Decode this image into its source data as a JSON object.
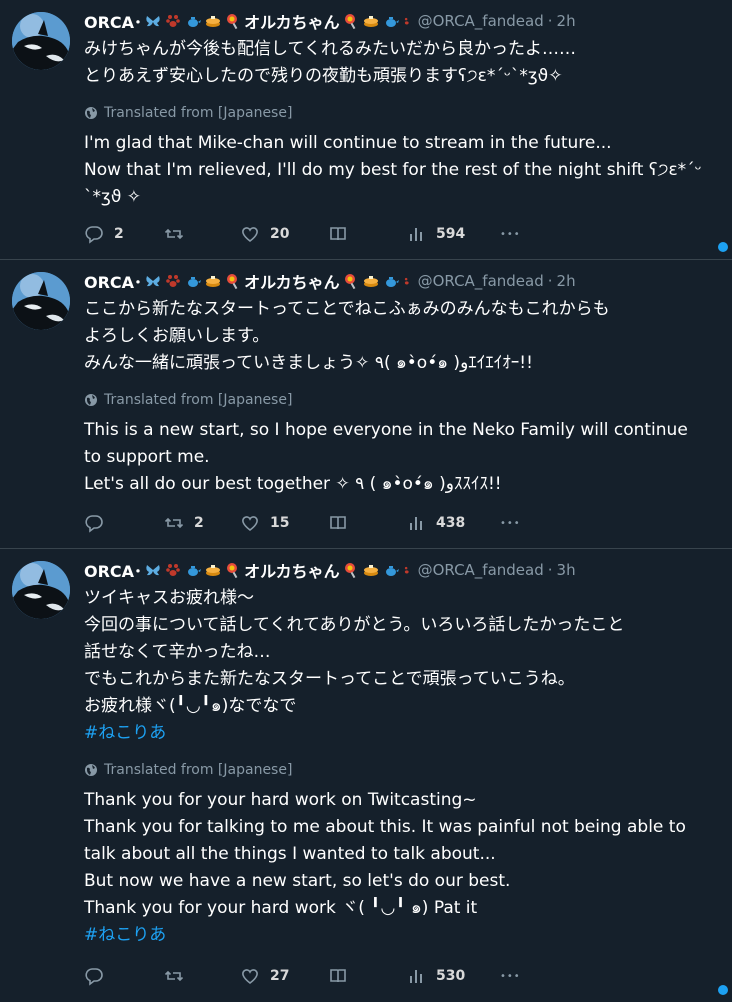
{
  "tweets": [
    {
      "display_name": "ORCA･",
      "name_suffix": "オルカちゃん",
      "handle": "@ORCA_fandead",
      "dot": "·",
      "time": "2h",
      "jp_lines": "みけちゃんが今後も配信してくれるみたいだから良かったよ……\nとりあえず安心したので残りの夜勤も頑張りますʕ੭ɛ*´ᵕ`*ʒϑ✧",
      "hashtag": "",
      "translated_label": "Translated from [Japanese]",
      "en_lines": "I'm glad that Mike-chan will continue to stream in the future...\nNow that I'm relieved, I'll do my best for the rest of the night shift ʕ੭ɛ*´ᵕ\n`*ʒϑ ✧",
      "replies": "2",
      "retweets": "",
      "likes": "20",
      "views": "594",
      "more": "•••"
    },
    {
      "display_name": "ORCA･",
      "name_suffix": "オルカちゃん",
      "handle": "@ORCA_fandead",
      "dot": "·",
      "time": "2h",
      "jp_lines": "ここから新たなスタートってことでねこふぁみのみんなもこれからも\nよろしくお願いします。\nみんな一緒に頑張っていきましょう✧ ٩( ๑•̀o•́๑ )وｴｲｴｲｵｰ!!",
      "hashtag": "",
      "translated_label": "Translated from [Japanese]",
      "en_lines": "This is a new start, so I hope everyone in the Neko Family will continue\nto support me.\nLet's all do our best together ✧ ٩ ( ๑•̀o•́๑ )وｽｽｲｽ!!",
      "replies": "",
      "retweets": "2",
      "likes": "15",
      "views": "438",
      "more": "•••"
    },
    {
      "display_name": "ORCA･",
      "name_suffix": "オルカちゃん",
      "handle": "@ORCA_fandead",
      "dot": "·",
      "time": "3h",
      "jp_lines": "ツイキャスお疲れ様〜\n今回の事について話してくれてありがとう。いろいろ話したかったこと\n話せなくて辛かったね…\nでもこれからまた新たなスタートってことで頑張っていこうね。\nお疲れ様ヾ(╹◡╹๑)なでなで",
      "hashtag": "#ねこりあ",
      "translated_label": "Translated from [Japanese]",
      "en_lines": "Thank you for your hard work on Twitcasting~\nThank you for talking to me about this. It was painful not being able to\ntalk about all the things I wanted to talk about...\nBut now we have a new start, so let's do our best.\nThank you for your hard work ヾ( ╹◡╹ ๑) Pat it",
      "en_hashtag": "#ねこりあ",
      "replies": "",
      "retweets": "",
      "likes": "27",
      "views": "530",
      "more": "•••"
    }
  ],
  "colors": {
    "background": "#15202b",
    "divider": "#38444d",
    "muted": "#8899a6",
    "accent": "#1da1f2"
  },
  "icons": {
    "reply": "reply-icon",
    "retweet": "retweet-icon",
    "like": "heart-icon",
    "bookmark": "bookmark-icon",
    "views": "bar-chart-icon",
    "more": "more-icon",
    "translate": "globe-icon"
  }
}
